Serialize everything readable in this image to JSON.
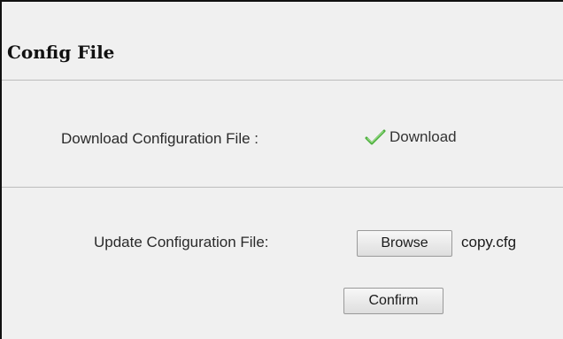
{
  "page": {
    "title": "Config File"
  },
  "download_section": {
    "label": "Download Configuration File :",
    "link_label": "Download",
    "link_icon": "checkmark-icon",
    "icon_color": "#4caf3c"
  },
  "update_section": {
    "label": "Update Configuration File:",
    "browse_label": "Browse",
    "selected_file": "copy.cfg",
    "confirm_label": "Confirm"
  }
}
